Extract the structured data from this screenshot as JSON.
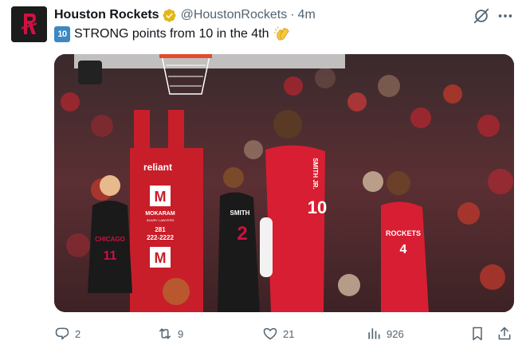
{
  "tweet": {
    "author_name": "Houston Rockets",
    "handle": "@HoustonRockets",
    "separator": "·",
    "time": "4m",
    "keycap": "10",
    "text": "STRONG points from 10 in the 4th"
  },
  "media": {
    "arena_signs": {
      "sponsor": "reliant",
      "letter_top": "M",
      "brand": "MOKARAM",
      "brand_sub": "INJURY LAWYERS",
      "phone_area": "281",
      "phone_number": "222-2222",
      "letter_bottom": "M"
    },
    "players": {
      "bulls_left_jersey": "CHICAGO",
      "bulls_left_number": "11",
      "bulls_right_name": "SMITH",
      "bulls_right_number": "2",
      "rockets_center_name": "SMITH JR.",
      "rockets_center_number": "10",
      "rockets_right_jersey": "ROCKETS",
      "rockets_right_number": "4"
    }
  },
  "actions": {
    "replies": "2",
    "reposts": "9",
    "likes": "21",
    "views": "926"
  },
  "colors": {
    "accent_blue": "#1d9bf0",
    "verified_gold": "#e2b719",
    "muted_text": "#536471",
    "rockets_red": "#ce1141"
  }
}
